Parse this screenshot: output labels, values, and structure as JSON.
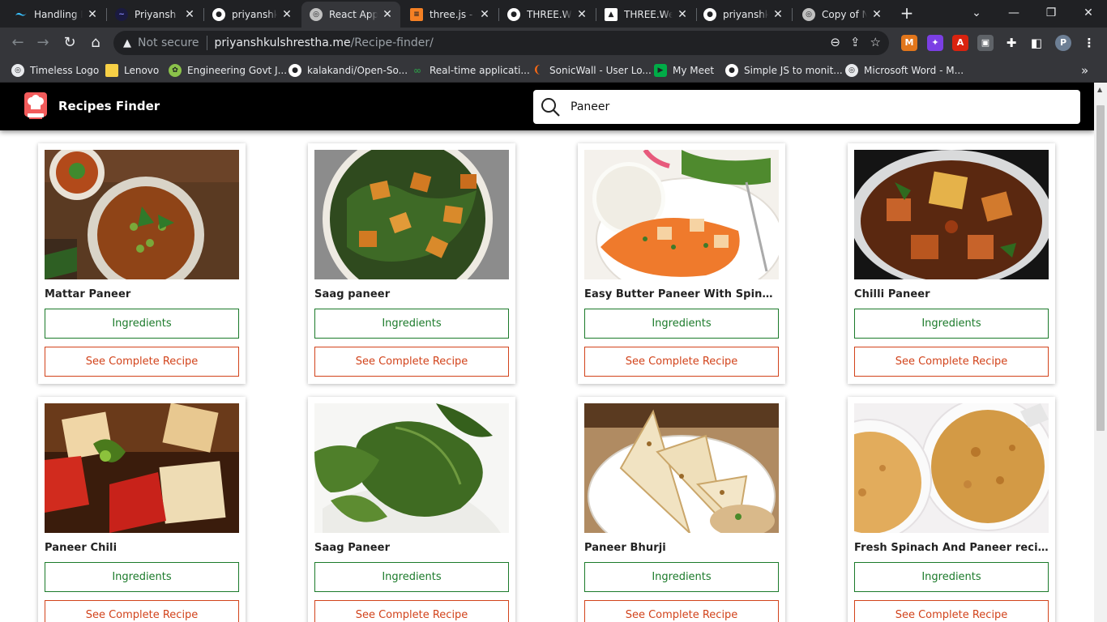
{
  "browser": {
    "tabs": [
      {
        "label": "Handling M",
        "icon": "tailwind-icon",
        "color": "#38bdf8"
      },
      {
        "label": "Priyansh Ku",
        "icon": "portfolio-icon",
        "color": "#8a8aff"
      },
      {
        "label": "priyanshku",
        "icon": "github-icon",
        "color": "#ffffff"
      },
      {
        "label": "React App",
        "icon": "globe-icon",
        "color": "#c0c0c0",
        "active": true
      },
      {
        "label": "three.js - W",
        "icon": "stackoverflow-icon",
        "color": "#f48024"
      },
      {
        "label": "THREE.Web",
        "icon": "github-icon",
        "color": "#ffffff"
      },
      {
        "label": "THREE.Web",
        "icon": "threejs-icon",
        "color": "#ffffff"
      },
      {
        "label": "priyanshku",
        "icon": "github-icon",
        "color": "#ffffff"
      },
      {
        "label": "Copy of Nu",
        "icon": "globe-icon",
        "color": "#c0c0c0"
      }
    ],
    "new_tab": "+",
    "address": {
      "security": "Not secure",
      "host": "priyanshkulshrestha.me",
      "path": "/Recipe-finder/"
    },
    "bookmarks": [
      {
        "label": "Timeless Logo",
        "icon": "globe-icon",
        "color": "#e8eaed"
      },
      {
        "label": "Lenovo",
        "icon": "folder-icon",
        "color": "#f7d046"
      },
      {
        "label": "Engineering Govt J...",
        "icon": "leaf-icon",
        "color": "#8bc34a"
      },
      {
        "label": "kalakandi/Open-So...",
        "icon": "github-icon",
        "color": "#ffffff"
      },
      {
        "label": "Real-time applicati...",
        "icon": "geeks-icon",
        "color": "#2f8d46"
      },
      {
        "label": "SonicWall - User Lo...",
        "icon": "sonicwall-icon",
        "color": "#ff6a13"
      },
      {
        "label": "My Meet",
        "icon": "meet-icon",
        "color": "#00ac47"
      },
      {
        "label": "Simple JS to monit...",
        "icon": "github-icon",
        "color": "#ffffff"
      },
      {
        "label": "Microsoft Word - M...",
        "icon": "globe-icon",
        "color": "#e8eaed"
      }
    ]
  },
  "app": {
    "title": "Recipes Finder",
    "search": {
      "value": "Paneer"
    },
    "ingredients_label": "Ingredients",
    "recipe_label": "See Complete Recipe",
    "colors": {
      "ingredients": "#1b7a2a",
      "recipe": "#d2431b",
      "header": "#000000"
    },
    "recipes": [
      {
        "title": "Mattar Paneer"
      },
      {
        "title": "Saag paneer"
      },
      {
        "title": "Easy Butter Paneer With Spinach Recipe"
      },
      {
        "title": "Chilli Paneer"
      },
      {
        "title": "Paneer Chili"
      },
      {
        "title": "Saag Paneer"
      },
      {
        "title": "Paneer Bhurji"
      },
      {
        "title": "Fresh Spinach And Paneer recipes"
      }
    ]
  }
}
